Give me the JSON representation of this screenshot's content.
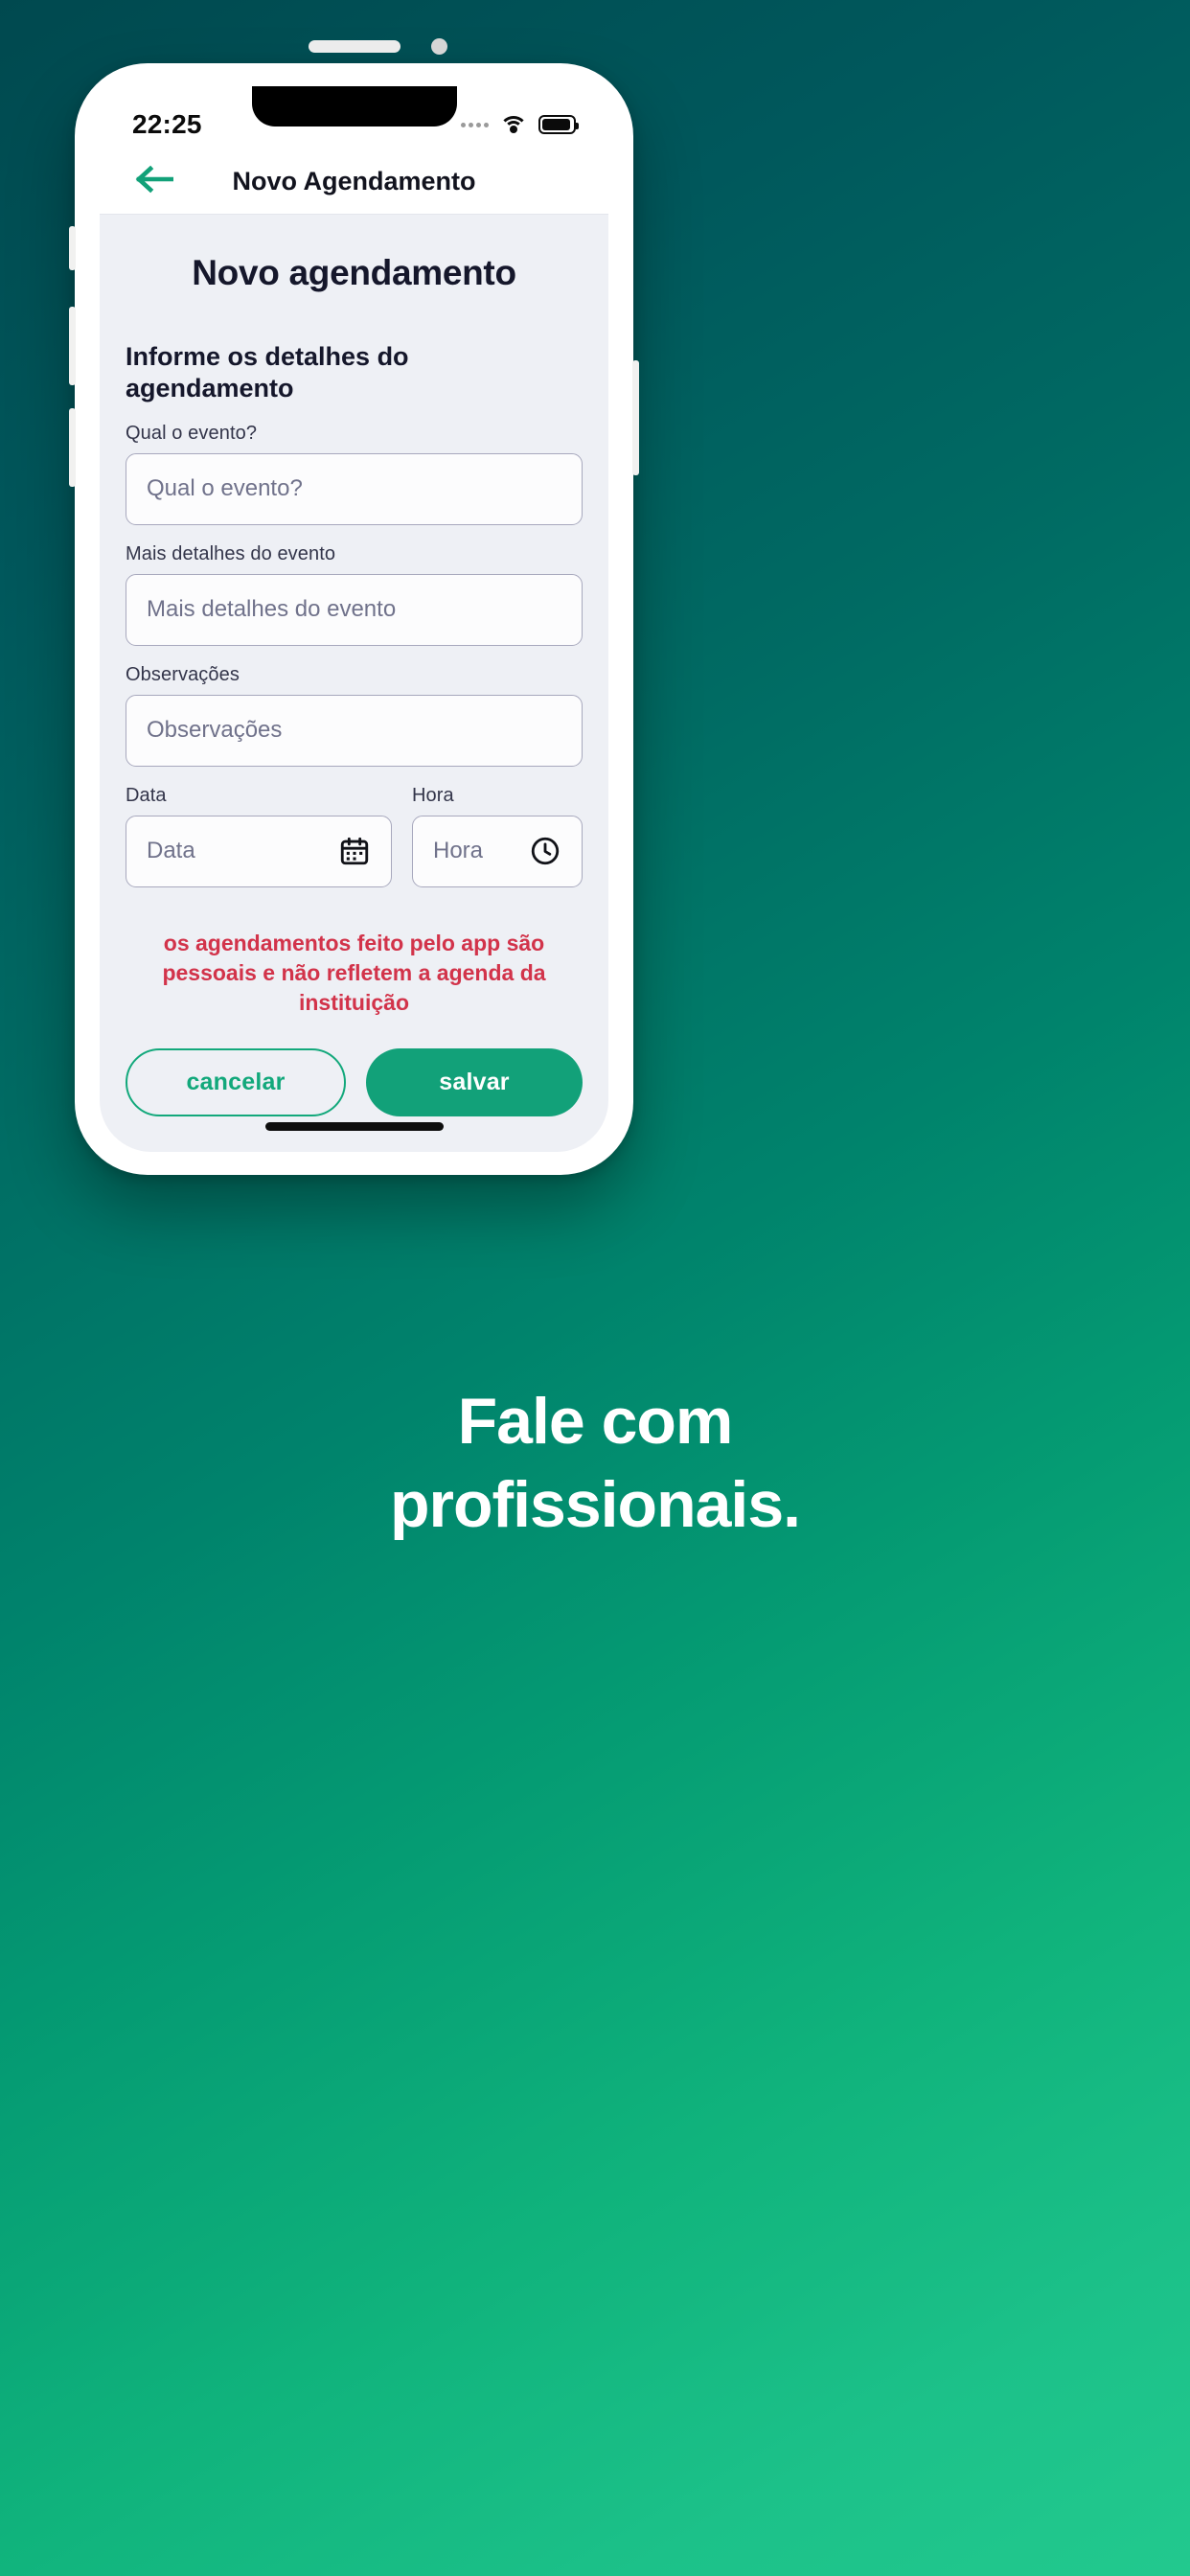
{
  "status_bar": {
    "time": "22:25",
    "signal_icon": "signal-dots-icon",
    "wifi_icon": "wifi-icon",
    "battery_icon": "battery-icon"
  },
  "app_bar": {
    "back_icon": "arrow-left-icon",
    "title": "Novo Agendamento"
  },
  "screen": {
    "page_title": "Novo agendamento",
    "section_heading": "Informe os detalhes do agendamento",
    "fields": [
      {
        "label": "Qual o evento?",
        "placeholder": "Qual o evento?",
        "value": "",
        "icon": ""
      },
      {
        "label": "Mais detalhes do evento",
        "placeholder": "Mais detalhes do evento",
        "value": "",
        "icon": ""
      },
      {
        "label": "Observações",
        "placeholder": "Observações",
        "value": "",
        "icon": ""
      }
    ],
    "date_field": {
      "label": "Data",
      "placeholder": "Data",
      "value": "",
      "icon": "calendar-icon"
    },
    "time_field": {
      "label": "Hora",
      "placeholder": "Hora",
      "value": "",
      "icon": "clock-icon"
    },
    "warning": "os agendamentos feito pelo app são pessoais e não refletem a agenda da instituição",
    "cancel_label": "cancelar",
    "save_label": "salvar"
  },
  "caption": {
    "line1": "Fale com",
    "line2": "profissionais."
  },
  "colors": {
    "brand_green": "#12a179",
    "outline_green": "#12a87b",
    "warning_red": "#d2334a",
    "dark_navy": "#15172b",
    "screen_bg": "#eef0f5",
    "field_border": "#a7a8bd",
    "placeholder": "#70728b",
    "bg_gradient_start": "#00494f",
    "bg_gradient_end": "#22c98e"
  }
}
